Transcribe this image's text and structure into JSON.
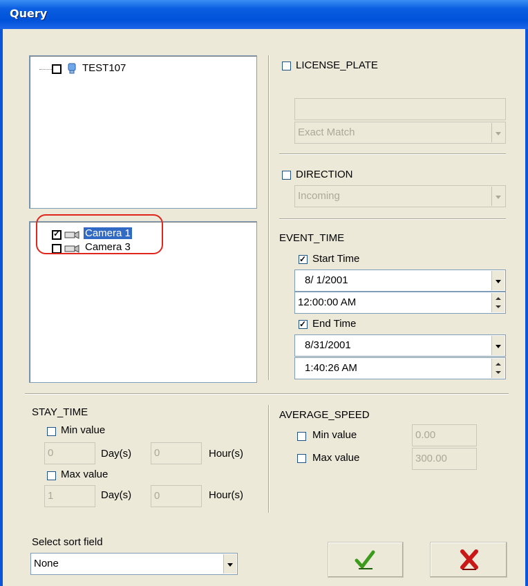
{
  "window": {
    "title": "Query"
  },
  "tree_top": {
    "node_label": "TEST107"
  },
  "tree_bottom": {
    "items": [
      {
        "label": "Camera 1",
        "checked": true,
        "selected": true
      },
      {
        "label": "Camera 3",
        "checked": false
      }
    ]
  },
  "license_plate": {
    "label": "LICENSE_PLATE",
    "value": "",
    "match_mode": "Exact Match"
  },
  "direction": {
    "label": "DIRECTION",
    "value": "Incoming"
  },
  "event_time": {
    "label": "EVENT_TIME",
    "start_label": "Start Time",
    "start_date": "8/ 1/2001",
    "start_time": "12:00:00 AM",
    "end_label": "End Time",
    "end_date": "8/31/2001",
    "end_time": "1:40:26 AM"
  },
  "stay_time": {
    "label": "STAY_TIME",
    "min_label": "Min value",
    "min_days": "0",
    "min_hours": "0",
    "max_label": "Max value",
    "max_days": "1",
    "max_hours": "0",
    "days_unit": "Day(s)",
    "hours_unit": "Hour(s)"
  },
  "average_speed": {
    "label": "AVERAGE_SPEED",
    "min_label": "Min value",
    "min_value": "0.00",
    "max_label": "Max value",
    "max_value": "300.00"
  },
  "sort": {
    "label": "Select sort field",
    "value": "None"
  },
  "colors": {
    "title_bar": "#0052d9",
    "dialog_bg": "#ece9d8",
    "selection": "#316ac5",
    "ok_check": "#3c9a1c",
    "cancel_x": "#c81818",
    "annotation": "#e0261c"
  },
  "buttons": {
    "ok_icon": "green-checkmark-icon",
    "cancel_icon": "red-x-icon"
  }
}
